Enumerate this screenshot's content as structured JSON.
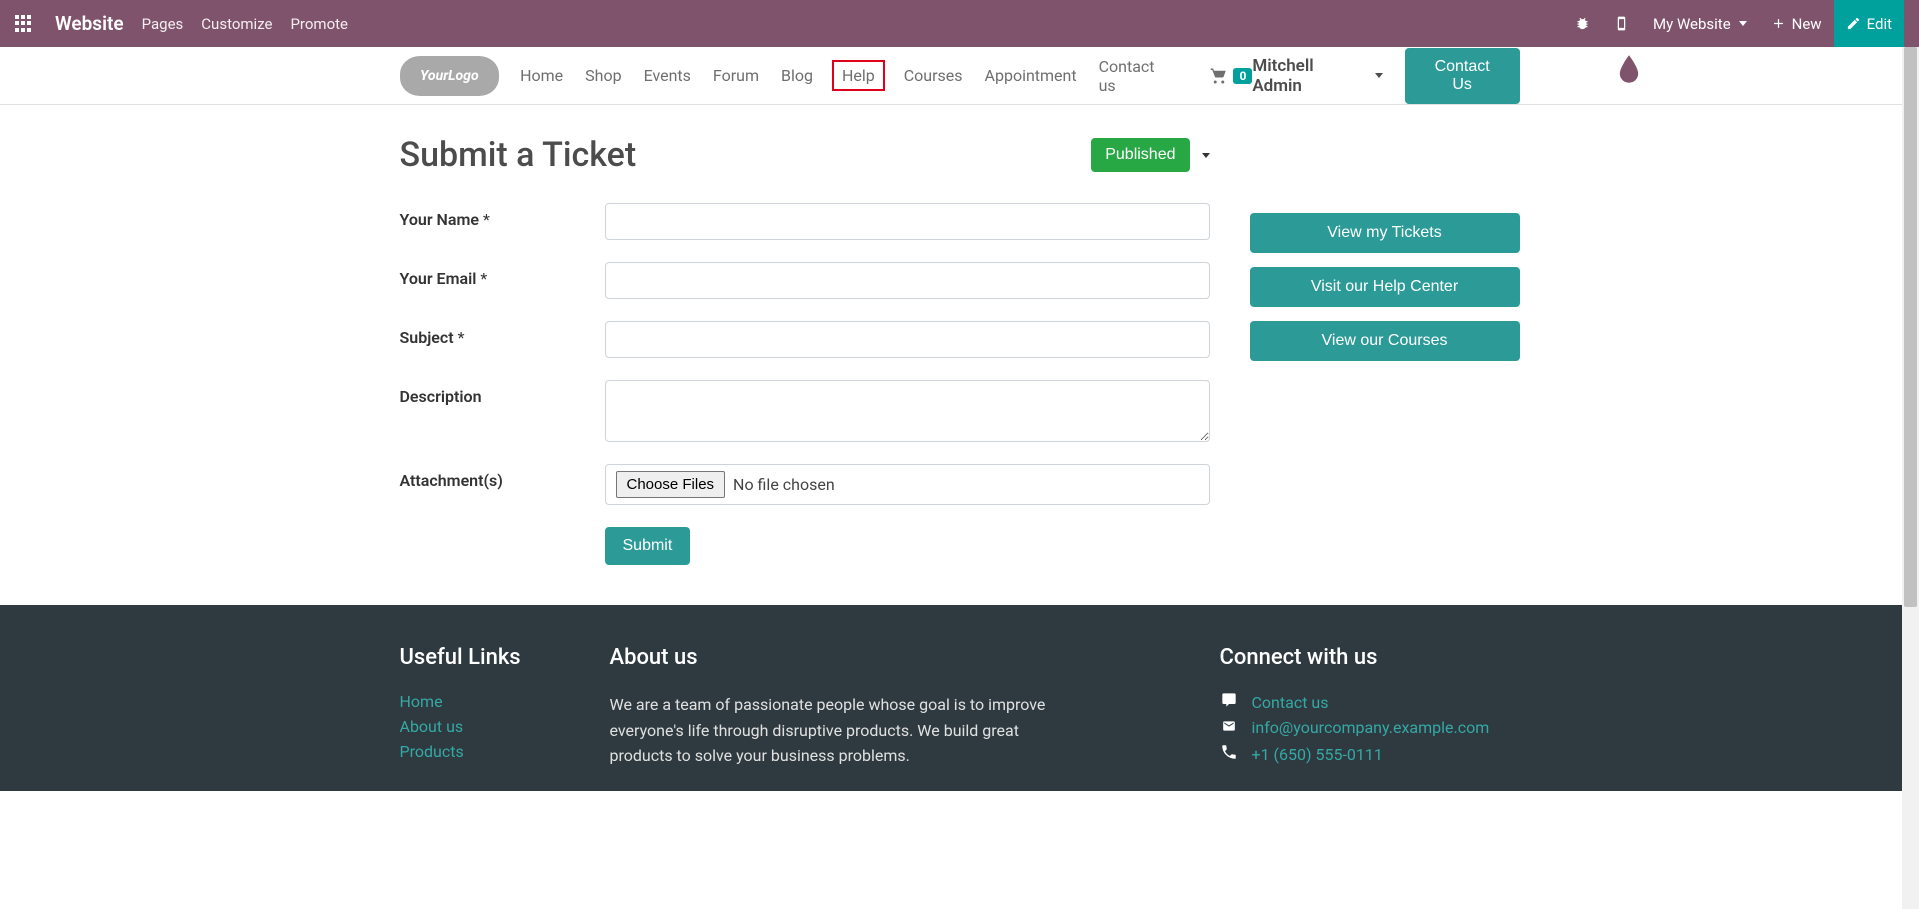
{
  "topbar": {
    "brand": "Website",
    "links": [
      "Pages",
      "Customize",
      "Promote"
    ],
    "my_website": "My Website",
    "new": "New",
    "edit": "Edit"
  },
  "nav": {
    "items": [
      "Home",
      "Shop",
      "Events",
      "Forum",
      "Blog",
      "Help",
      "Courses",
      "Appointment",
      "Contact us"
    ],
    "highlighted_index": 5,
    "cart_count": "0",
    "user": "Mitchell Admin",
    "contact_btn": "Contact Us"
  },
  "page": {
    "title": "Submit a Ticket",
    "published": "Published"
  },
  "form": {
    "name_label": "Your Name",
    "email_label": "Your Email",
    "subject_label": "Subject",
    "description_label": "Description",
    "attachments_label": "Attachment(s)",
    "required": "*",
    "choose_files": "Choose Files",
    "no_file": "No file chosen",
    "submit": "Submit"
  },
  "side": {
    "view_tickets": "View my Tickets",
    "help_center": "Visit our Help Center",
    "courses": "View our Courses"
  },
  "footer": {
    "useful_title": "Useful Links",
    "useful_links": [
      "Home",
      "About us",
      "Products"
    ],
    "about_title": "About us",
    "about_text": "We are a team of passionate people whose goal is to improve everyone's life through disruptive products. We build great products to solve your business problems.",
    "connect_title": "Connect with us",
    "contact_us": "Contact us",
    "email": "info@yourcompany.example.com",
    "phone": "+1 (650) 555-0111"
  }
}
